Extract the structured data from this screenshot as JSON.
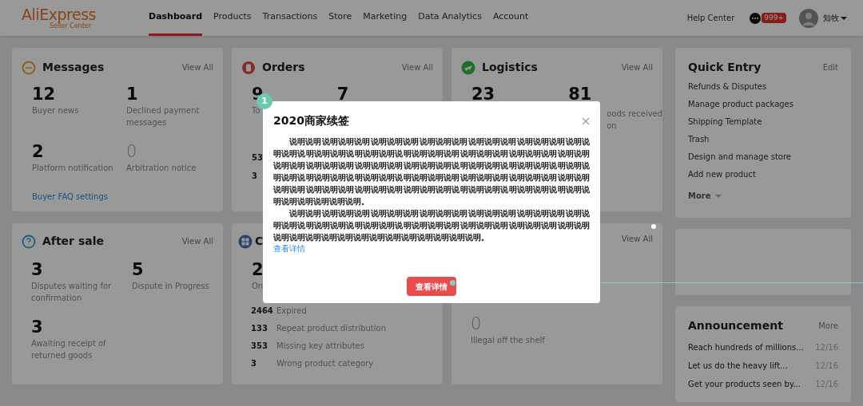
{
  "nav": {
    "logo": "AliExpress",
    "logo_sub": "Seller Center",
    "items": [
      {
        "label": "Dashboard",
        "selected": true
      },
      {
        "label": "Products",
        "selected": false
      },
      {
        "label": "Transactions",
        "selected": false
      },
      {
        "label": "Store",
        "selected": false
      },
      {
        "label": "Marketing",
        "selected": false
      },
      {
        "label": "Data Analytics",
        "selected": false
      },
      {
        "label": "Account",
        "selected": false
      }
    ],
    "help": "Help Center",
    "badge": "999+",
    "user": "知牧"
  },
  "messages": {
    "title": "Messages",
    "action": "View All",
    "stats": [
      {
        "value": "12",
        "label": "Buyer news",
        "muted": false
      },
      {
        "value": "1",
        "label": "Declined payment messages",
        "muted": false
      },
      {
        "value": "2",
        "label": "Platform notification",
        "muted": false
      },
      {
        "value": "0",
        "label": "Arbitration notice",
        "muted": true
      }
    ],
    "link": "Buyer FAQ settings"
  },
  "orders": {
    "title": "Orders",
    "action": "View All",
    "stats": [
      {
        "value": "9",
        "label": "To"
      },
      {
        "value": "7"
      }
    ],
    "counts": [
      "53",
      "3"
    ]
  },
  "logistics": {
    "title": "Logistics",
    "action": "View All",
    "stats": [
      {
        "value": "23"
      },
      {
        "value": "81",
        "label_lines": [
          "oods received",
          "on"
        ]
      }
    ]
  },
  "after_sale": {
    "title": "After sale",
    "action": "View All",
    "stats": [
      {
        "value": "3",
        "label": "Disputes waiting for confirmation"
      },
      {
        "value": "5",
        "label": "Dispute in Progress"
      },
      {
        "value": "3",
        "label": "Awaiting receipt of returned goods"
      }
    ]
  },
  "products": {
    "title": "C",
    "stat": {
      "value": "2",
      "label": "On"
    },
    "list": [
      {
        "count": "2464",
        "label": "Expired"
      },
      {
        "count": "133",
        "label": "Repeat product distribution"
      },
      {
        "count": "353",
        "label": "Missing key attributes"
      },
      {
        "count": "3",
        "label": "Wrong product category"
      }
    ]
  },
  "violations": {
    "action": "View All",
    "stat": {
      "value": "0",
      "label": "Illegal off the shelf"
    }
  },
  "quick_entry": {
    "title": "Quick Entry",
    "action": "Edit",
    "items": [
      "Refunds & Disputes",
      "Manage product packages",
      "Shipping Template",
      "Trash",
      "Design and manage store",
      "Add new product"
    ],
    "more": "More"
  },
  "announcement": {
    "title": "Announcement",
    "action": "More",
    "items": [
      {
        "text": "Reach hundreds of millions...",
        "date": "12/16"
      },
      {
        "text": "Let us do the heavy lift...",
        "date": "12/16"
      },
      {
        "text": "Get your products seen by...",
        "date": "12/16"
      }
    ]
  },
  "modal": {
    "badge": "1",
    "title": "2020商家续签",
    "paragraphs": [
      "说明说明说明说明说明说明说明说明说明说明说明说明说明说明说明说明说明说明说明说明说明说明说明说明说明说明说明说明说明说明说明说明说明说明说明说明说明说明说明说明说明说明说明说明说明说明说明说明说明说明说明说明说明说明说明说明说明说明说明说明说明说明说明说明说明说明说明说明说明说明说明说明说明说明说明说明说明说明说明说明说明说明说明说明说明说明说明说明说明说明说明说明说明说明说明说明说明说明说明说明说明说明。",
      "说明说明说明说明说明说明说明说明说明说明说明说明说明说明说明说明说明说明说明说明说明说明说明说明说明说明说明说明说明说明说明说明说明说明说明说明说明说明说明说明说明说明说明说明说明说明说明说明说明说明说明。"
    ],
    "link": "查看详情",
    "button": "查看详情"
  }
}
